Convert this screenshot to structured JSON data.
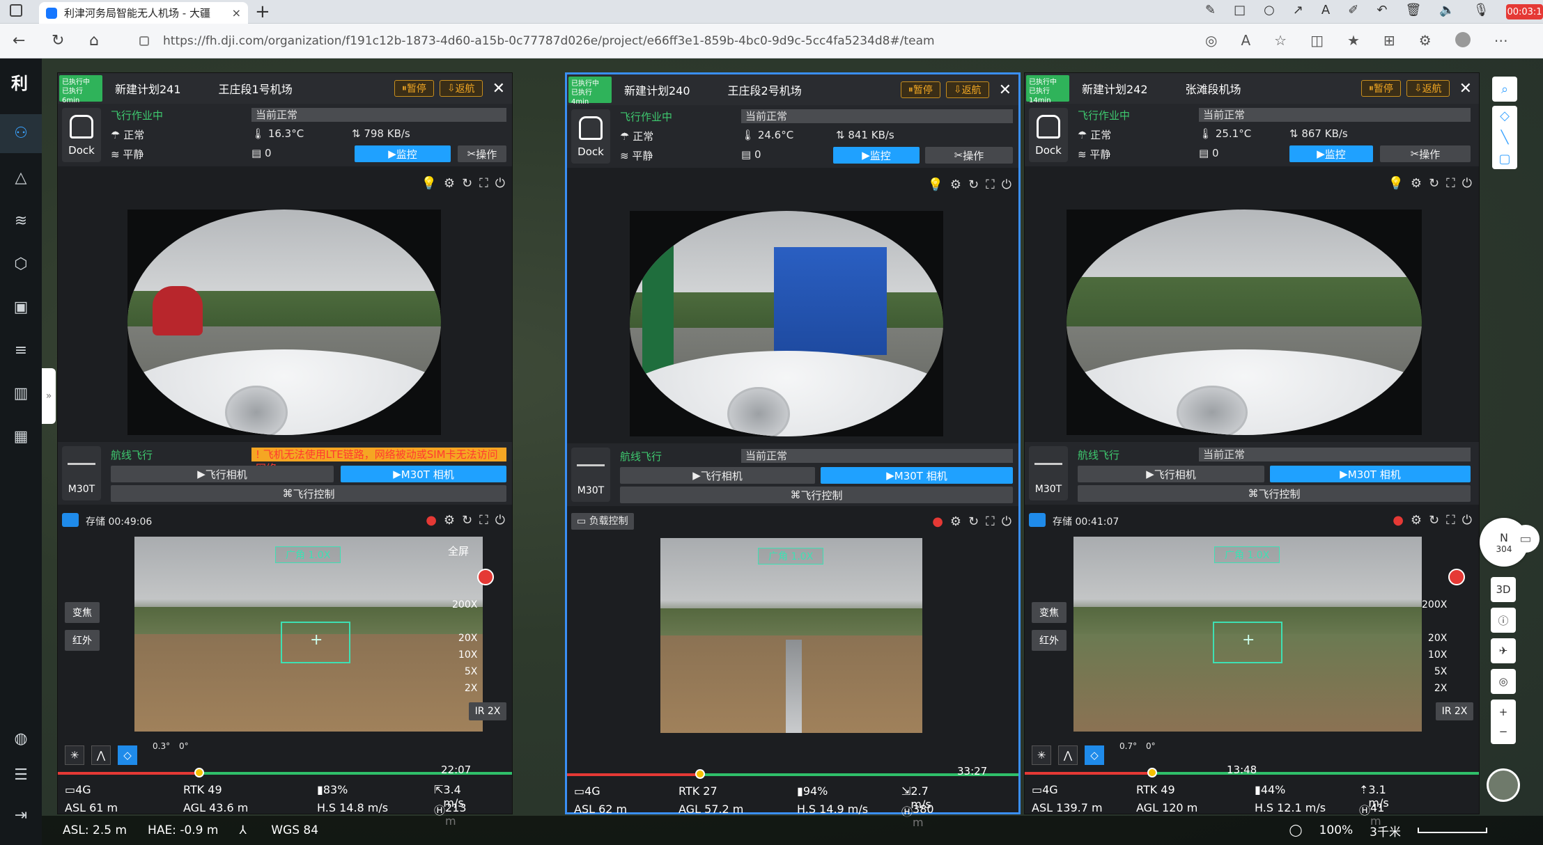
{
  "browser": {
    "tab_title": "利津河务局智能无人机场 - 大疆",
    "new_tab": "+",
    "url": "https://fh.dji.com/organization/f191c12b-1873-4d60-a15b-0c77787d026e/project/e66ff3e1-859b-4bc0-9d9c-5cc4fa5234d8#/team",
    "recording": "00:03:1"
  },
  "app": {
    "logo": "利"
  },
  "panels": [
    {
      "status": "已执行中",
      "status_sub": "已执行 6min",
      "plan": "新建计划241",
      "dock": "王庄段1号机场",
      "pause": "暂停",
      "return": "返航",
      "task_state": "飞行作业中",
      "task_note": "当前正常",
      "dock_label": "Dock",
      "dock_status": "正常",
      "temp": "16.3°C",
      "net": "798 KB/s",
      "wind": "平静",
      "count": "0",
      "monitor": "监控",
      "operate": "操作",
      "flight_mode": "航线飞行",
      "alert": "飞机无法使用LTE链路，网络被动或SIM卡无法访问网络",
      "alert_badge": "!",
      "drone": "M30T",
      "fly_cam": "飞行相机",
      "payload_cam": "M30T 相机",
      "fly_ctrl": "飞行控制",
      "storage": "存储 00:49:06",
      "payload_ctrl": "",
      "zoom": "广角 1.0X",
      "fullscreen": "全屏",
      "zoom_btn": "变焦",
      "ir_btn": "红外",
      "zooms": [
        "200X",
        "20X",
        "10X",
        "5X",
        "2X"
      ],
      "ir": "IR 2X",
      "gimbal1": "0.3°",
      "gimbal2": "0°",
      "elapsed": "22:07",
      "signal": "4G",
      "rtk": "RTK 49",
      "battery": "83%",
      "vspeed": "3.4 m/s",
      "asl": "ASL 61 m",
      "agl": "AGL 43.6 m",
      "hs": "H.S 14.8 m/s",
      "home": "213 m"
    },
    {
      "status": "已执行中",
      "status_sub": "已执行 4min",
      "plan": "新建计划240",
      "dock": "王庄段2号机场",
      "pause": "暂停",
      "return": "返航",
      "task_state": "飞行作业中",
      "task_note": "当前正常",
      "dock_label": "Dock",
      "dock_status": "正常",
      "temp": "24.6°C",
      "net": "841 KB/s",
      "wind": "平静",
      "count": "0",
      "monitor": "监控",
      "operate": "操作",
      "flight_mode": "航线飞行",
      "alert": "当前正常",
      "alert_badge": "",
      "drone": "M30T",
      "fly_cam": "飞行相机",
      "payload_cam": "M30T 相机",
      "fly_ctrl": "飞行控制",
      "storage": "",
      "payload_ctrl": "负载控制",
      "zoom": "广角 1.0X",
      "fullscreen": "",
      "zoom_btn": "",
      "ir_btn": "",
      "zooms": [],
      "ir": "",
      "gimbal1": "",
      "gimbal2": "",
      "elapsed": "33:27",
      "signal": "4G",
      "rtk": "RTK 27",
      "battery": "94%",
      "vspeed": "2.7 m/s",
      "asl": "ASL 62 m",
      "agl": "AGL 57.2 m",
      "hs": "H.S 14.9 m/s",
      "home": "380 m"
    },
    {
      "status": "已执行中",
      "status_sub": "已执行 14min",
      "plan": "新建计划242",
      "dock": "张滩段机场",
      "pause": "暂停",
      "return": "返航",
      "task_state": "飞行作业中",
      "task_note": "当前正常",
      "dock_label": "Dock",
      "dock_status": "正常",
      "temp": "25.1°C",
      "net": "867 KB/s",
      "wind": "平静",
      "count": "0",
      "monitor": "监控",
      "operate": "操作",
      "flight_mode": "航线飞行",
      "alert": "当前正常",
      "alert_badge": "",
      "drone": "M30T",
      "fly_cam": "飞行相机",
      "payload_cam": "M30T 相机",
      "fly_ctrl": "飞行控制",
      "storage": "存储 00:41:07",
      "payload_ctrl": "",
      "zoom": "广角 1.0X",
      "fullscreen": "",
      "zoom_btn": "变焦",
      "ir_btn": "红外",
      "zooms": [
        "200X",
        "20X",
        "10X",
        "5X",
        "2X"
      ],
      "ir": "IR 2X",
      "gimbal1": "0.7°",
      "gimbal2": "0°",
      "elapsed": "13:48",
      "signal": "4G",
      "rtk": "RTK 49",
      "battery": "44%",
      "vspeed": "3.1 m/s",
      "asl": "ASL 139.7 m",
      "agl": "AGL 120 m",
      "hs": "H.S 12.1 m/s",
      "home": "41 m"
    }
  ],
  "map": {
    "compass": "N",
    "heading": "304",
    "btn_3d": "3D",
    "zoom_in": "+",
    "zoom_out": "−"
  },
  "bottom": {
    "asl": "ASL: 2.5 m",
    "hae": "HAE: -0.9 m",
    "datum": "WGS 84",
    "zoom_pct": "100%",
    "scale": "3千米"
  }
}
